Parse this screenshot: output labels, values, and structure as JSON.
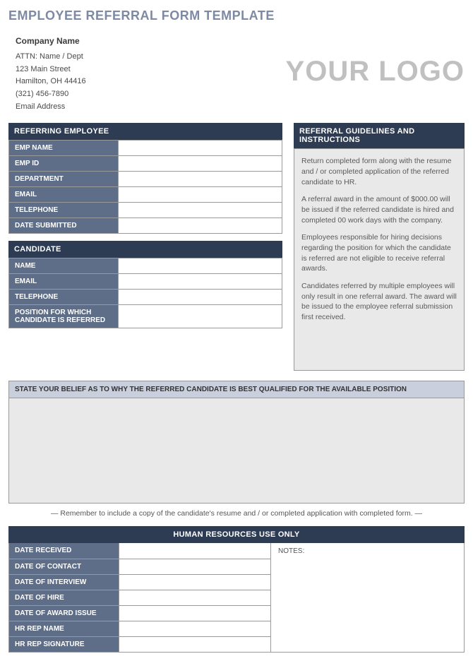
{
  "title": "EMPLOYEE REFERRAL FORM TEMPLATE",
  "company": {
    "name": "Company Name",
    "attn": "ATTN: Name / Dept",
    "street": "123 Main Street",
    "city_line": "Hamilton, OH  44416",
    "phone": "(321) 456-7890",
    "email": "Email Address"
  },
  "logo_text": "YOUR LOGO",
  "referring": {
    "header": "REFERRING EMPLOYEE",
    "fields": [
      {
        "label": "EMP NAME",
        "value": ""
      },
      {
        "label": "EMP ID",
        "value": ""
      },
      {
        "label": "DEPARTMENT",
        "value": ""
      },
      {
        "label": "EMAIL",
        "value": ""
      },
      {
        "label": "TELEPHONE",
        "value": ""
      },
      {
        "label": "DATE SUBMITTED",
        "value": ""
      }
    ]
  },
  "candidate": {
    "header": "CANDIDATE",
    "fields": [
      {
        "label": "NAME",
        "value": ""
      },
      {
        "label": "EMAIL",
        "value": ""
      },
      {
        "label": "TELEPHONE",
        "value": ""
      },
      {
        "label": "POSITION FOR WHICH CANDIDATE IS REFERRED",
        "value": ""
      }
    ]
  },
  "guidelines": {
    "header": "REFERRAL GUIDELINES AND INSTRUCTIONS",
    "paragraphs": [
      "Return completed form along with the resume and / or completed application of the referred candidate to HR.",
      "A referral award in the amount of $000.00 will be issued if the referred candidate is hired and completed 00 work days with the company.",
      "Employees responsible for hiring decisions regarding the position for which the candidate is referred are not eligible to receive referral awards.",
      "Candidates referred by multiple employees will only result in one referral award.  The award will be issued to the employee referral submission first received."
    ]
  },
  "belief": {
    "header": "STATE YOUR BELIEF AS TO WHY THE REFERRED CANDIDATE IS BEST QUALIFIED FOR THE AVAILABLE POSITION",
    "value": ""
  },
  "reminder": "— Remember to include a copy of the candidate's resume and / or completed application with completed form. —",
  "hr": {
    "header": "HUMAN RESOURCES USE ONLY",
    "notes_label": "NOTES:",
    "notes_value": "",
    "fields": [
      {
        "label": "DATE RECEIVED",
        "value": ""
      },
      {
        "label": "DATE OF CONTACT",
        "value": ""
      },
      {
        "label": "DATE OF INTERVIEW",
        "value": ""
      },
      {
        "label": "DATE OF HIRE",
        "value": ""
      },
      {
        "label": "DATE OF AWARD ISSUE",
        "value": ""
      },
      {
        "label": "HR REP NAME",
        "value": ""
      },
      {
        "label": "HR REP SIGNATURE",
        "value": ""
      }
    ]
  }
}
